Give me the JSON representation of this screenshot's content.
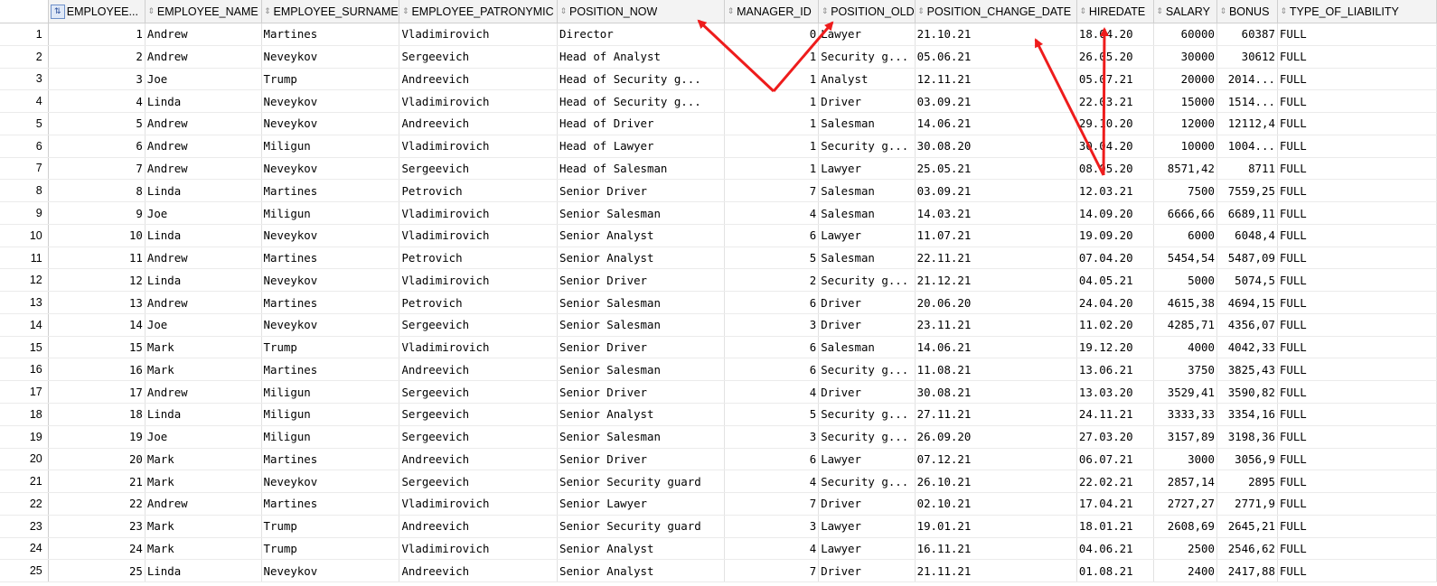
{
  "columns": [
    {
      "key": "employee_id",
      "label": "EMPLOYEE...",
      "align": "num",
      "icon": "key-icon"
    },
    {
      "key": "employee_name",
      "label": "EMPLOYEE_NAME",
      "align": "txt"
    },
    {
      "key": "employee_surname",
      "label": "EMPLOYEE_SURNAME",
      "align": "txt"
    },
    {
      "key": "employee_patronymic",
      "label": "EMPLOYEE_PATRONYMIC",
      "align": "txt"
    },
    {
      "key": "position_now",
      "label": "POSITION_NOW",
      "align": "txt"
    },
    {
      "key": "manager_id",
      "label": "MANAGER_ID",
      "align": "num"
    },
    {
      "key": "position_old",
      "label": "POSITION_OLD",
      "align": "txt"
    },
    {
      "key": "position_change_date",
      "label": "POSITION_CHANGE_DATE",
      "align": "txt"
    },
    {
      "key": "hiredate",
      "label": "HIREDATE",
      "align": "txt"
    },
    {
      "key": "salary",
      "label": "SALARY",
      "align": "num"
    },
    {
      "key": "bonus",
      "label": "BONUS",
      "align": "num"
    },
    {
      "key": "type_of_liability",
      "label": "TYPE_OF_LIABILITY",
      "align": "txt"
    }
  ],
  "rows": [
    [
      "1",
      "1",
      "Andrew",
      "Martines",
      "Vladimirovich",
      "Director",
      "0",
      "Lawyer",
      "21.10.21",
      "18.04.20",
      "60000",
      "60387",
      "FULL"
    ],
    [
      "2",
      "2",
      "Andrew",
      "Neveykov",
      "Sergeevich",
      "Head of Analyst",
      "1",
      "Security g...",
      "05.06.21",
      "26.05.20",
      "30000",
      "30612",
      "FULL"
    ],
    [
      "3",
      "3",
      "Joe",
      "Trump",
      "Andreevich",
      "Head of Security g...",
      "1",
      "Analyst",
      "12.11.21",
      "05.07.21",
      "20000",
      "2014...",
      "FULL"
    ],
    [
      "4",
      "4",
      "Linda",
      "Neveykov",
      "Vladimirovich",
      "Head of Security g...",
      "1",
      "Driver",
      "03.09.21",
      "22.03.21",
      "15000",
      "1514...",
      "FULL"
    ],
    [
      "5",
      "5",
      "Andrew",
      "Neveykov",
      "Andreevich",
      "Head of Driver",
      "1",
      "Salesman",
      "14.06.21",
      "29.10.20",
      "12000",
      "12112,4",
      "FULL"
    ],
    [
      "6",
      "6",
      "Andrew",
      "Miligun",
      "Vladimirovich",
      "Head of Lawyer",
      "1",
      "Security g...",
      "30.08.20",
      "30.04.20",
      "10000",
      "1004...",
      "FULL"
    ],
    [
      "7",
      "7",
      "Andrew",
      "Neveykov",
      "Sergeevich",
      "Head of Salesman",
      "1",
      "Lawyer",
      "25.05.21",
      "08.05.20",
      "8571,42",
      "8711",
      "FULL"
    ],
    [
      "8",
      "8",
      "Linda",
      "Martines",
      "Petrovich",
      "Senior Driver",
      "7",
      "Salesman",
      "03.09.21",
      "12.03.21",
      "7500",
      "7559,25",
      "FULL"
    ],
    [
      "9",
      "9",
      "Joe",
      "Miligun",
      "Vladimirovich",
      "Senior Salesman",
      "4",
      "Salesman",
      "14.03.21",
      "14.09.20",
      "6666,66",
      "6689,11",
      "FULL"
    ],
    [
      "10",
      "10",
      "Linda",
      "Neveykov",
      "Vladimirovich",
      "Senior Analyst",
      "6",
      "Lawyer",
      "11.07.21",
      "19.09.20",
      "6000",
      "6048,4",
      "FULL"
    ],
    [
      "11",
      "11",
      "Andrew",
      "Martines",
      "Petrovich",
      "Senior Analyst",
      "5",
      "Salesman",
      "22.11.21",
      "07.04.20",
      "5454,54",
      "5487,09",
      "FULL"
    ],
    [
      "12",
      "12",
      "Linda",
      "Neveykov",
      "Vladimirovich",
      "Senior Driver",
      "2",
      "Security g...",
      "21.12.21",
      "04.05.21",
      "5000",
      "5074,5",
      "FULL"
    ],
    [
      "13",
      "13",
      "Andrew",
      "Martines",
      "Petrovich",
      "Senior Salesman",
      "6",
      "Driver",
      "20.06.20",
      "24.04.20",
      "4615,38",
      "4694,15",
      "FULL"
    ],
    [
      "14",
      "14",
      "Joe",
      "Neveykov",
      "Sergeevich",
      "Senior Salesman",
      "3",
      "Driver",
      "23.11.21",
      "11.02.20",
      "4285,71",
      "4356,07",
      "FULL"
    ],
    [
      "15",
      "15",
      "Mark",
      "Trump",
      "Vladimirovich",
      "Senior Driver",
      "6",
      "Salesman",
      "14.06.21",
      "19.12.20",
      "4000",
      "4042,33",
      "FULL"
    ],
    [
      "16",
      "16",
      "Mark",
      "Martines",
      "Andreevich",
      "Senior Salesman",
      "6",
      "Security g...",
      "11.08.21",
      "13.06.21",
      "3750",
      "3825,43",
      "FULL"
    ],
    [
      "17",
      "17",
      "Andrew",
      "Miligun",
      "Sergeevich",
      "Senior Driver",
      "4",
      "Driver",
      "30.08.21",
      "13.03.20",
      "3529,41",
      "3590,82",
      "FULL"
    ],
    [
      "18",
      "18",
      "Linda",
      "Miligun",
      "Sergeevich",
      "Senior Analyst",
      "5",
      "Security g...",
      "27.11.21",
      "24.11.21",
      "3333,33",
      "3354,16",
      "FULL"
    ],
    [
      "19",
      "19",
      "Joe",
      "Miligun",
      "Sergeevich",
      "Senior Salesman",
      "3",
      "Security g...",
      "26.09.20",
      "27.03.20",
      "3157,89",
      "3198,36",
      "FULL"
    ],
    [
      "20",
      "20",
      "Mark",
      "Martines",
      "Andreevich",
      "Senior Driver",
      "6",
      "Lawyer",
      "07.12.21",
      "06.07.21",
      "3000",
      "3056,9",
      "FULL"
    ],
    [
      "21",
      "21",
      "Mark",
      "Neveykov",
      "Sergeevich",
      "Senior Security guard",
      "4",
      "Security g...",
      "26.10.21",
      "22.02.21",
      "2857,14",
      "2895",
      "FULL"
    ],
    [
      "22",
      "22",
      "Andrew",
      "Martines",
      "Vladimirovich",
      "Senior Lawyer",
      "7",
      "Driver",
      "02.10.21",
      "17.04.21",
      "2727,27",
      "2771,9",
      "FULL"
    ],
    [
      "23",
      "23",
      "Mark",
      "Trump",
      "Andreevich",
      "Senior Security guard",
      "3",
      "Lawyer",
      "19.01.21",
      "18.01.21",
      "2608,69",
      "2645,21",
      "FULL"
    ],
    [
      "24",
      "24",
      "Mark",
      "Trump",
      "Vladimirovich",
      "Senior Analyst",
      "4",
      "Lawyer",
      "16.11.21",
      "04.06.21",
      "2500",
      "2546,62",
      "FULL"
    ],
    [
      "25",
      "25",
      "Linda",
      "Neveykov",
      "Andreevich",
      "Senior Analyst",
      "7",
      "Driver",
      "21.11.21",
      "01.08.21",
      "2400",
      "2417,88",
      "FULL"
    ]
  ],
  "annotation_color": "#ee1c1c",
  "sort_icon": "sort-updown-icon"
}
